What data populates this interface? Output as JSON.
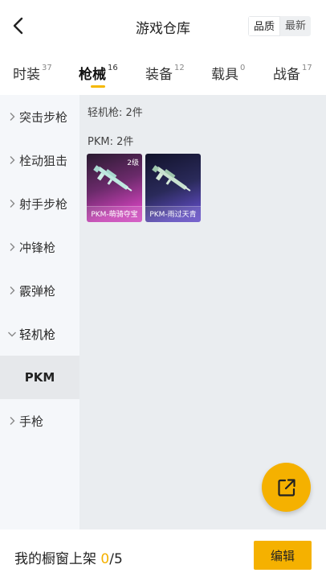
{
  "header": {
    "title": "游戏仓库",
    "sort_options": [
      "品质",
      "最新"
    ],
    "active_sort": "品质"
  },
  "tabs": [
    {
      "label": "时装",
      "count": "37"
    },
    {
      "label": "枪械",
      "count": "16"
    },
    {
      "label": "装备",
      "count": "12"
    },
    {
      "label": "载具",
      "count": "0"
    },
    {
      "label": "战备",
      "count": "17"
    }
  ],
  "sidebar": {
    "categories": [
      "突击步枪",
      "栓动狙击",
      "射手步枪",
      "冲锋枪",
      "霰弹枪",
      "轻机枪"
    ],
    "expanded_sub": "PKM",
    "last_category": "手枪"
  },
  "main": {
    "section_label": "轻机枪: 2件",
    "group_label": "PKM: 2件",
    "items": [
      {
        "name": "PKM-萌骑夺宝",
        "badge": "2级",
        "rarity": "pink"
      },
      {
        "name": "PKM-雨过天青",
        "badge": "",
        "rarity": "blue"
      }
    ]
  },
  "bottom": {
    "showcase_prefix": "我的橱窗上架 ",
    "showcase_current": "0",
    "showcase_total": "/5",
    "edit_label": "编辑"
  },
  "colors": {
    "accent": "#f5b100",
    "sidebar_bg": "#f5f7fa",
    "main_bg": "#eaedf0"
  },
  "icons": {
    "back": "chevron-left-icon",
    "fab": "share-external-icon"
  }
}
